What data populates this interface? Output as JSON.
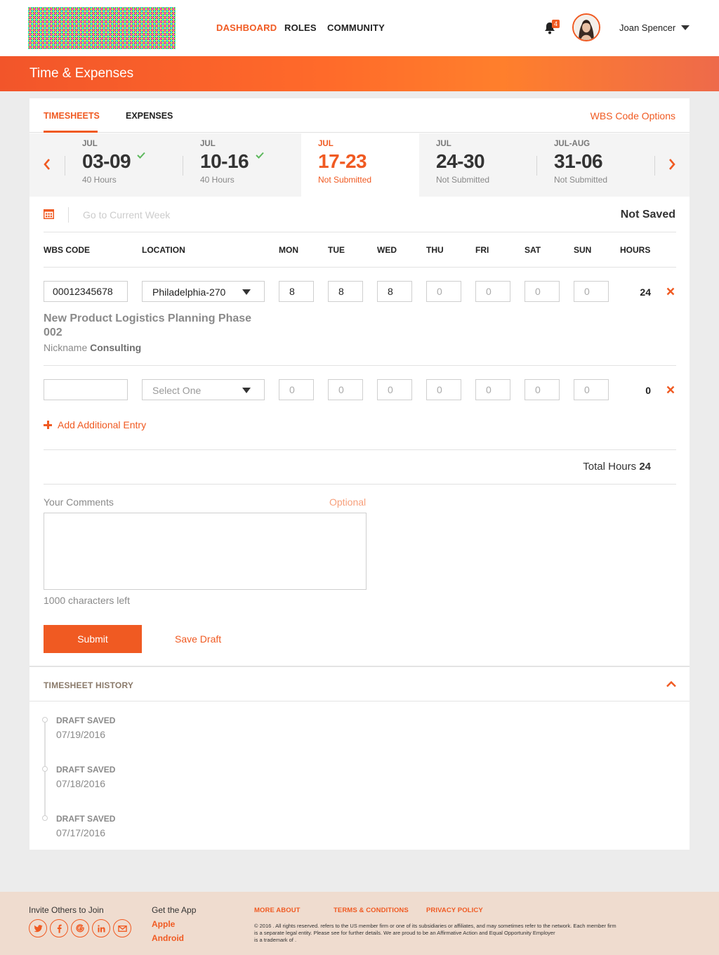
{
  "header": {
    "nav": [
      "DASHBOARD",
      "ROLES",
      "COMMUNITY"
    ],
    "notifications_count": "4",
    "user_name": "Joan Spencer"
  },
  "banner": {
    "title": "Time & Expenses"
  },
  "tabs": [
    "TIMESHEETS",
    "EXPENSES"
  ],
  "wbs_options": "WBS Code Options",
  "weeks": [
    {
      "month": "JUL",
      "range": "03-09",
      "status": "40 Hours",
      "approved": true
    },
    {
      "month": "JUL",
      "range": "10-16",
      "status": "40 Hours",
      "approved": true
    },
    {
      "month": "JUL",
      "range": "17-23",
      "status": "Not Submitted",
      "selected": true
    },
    {
      "month": "JUL",
      "range": "24-30",
      "status": "Not Submitted"
    },
    {
      "month": "JUL-AUG",
      "range": "31-06",
      "status": "Not Submitted"
    }
  ],
  "toolbar": {
    "go_current": "Go to Current Week",
    "save_state": "Not Saved"
  },
  "columns": [
    "WBS CODE",
    "LOCATION",
    "MON",
    "TUE",
    "WED",
    "THU",
    "FRI",
    "SAT",
    "SUN",
    "HOURS"
  ],
  "rows": [
    {
      "wbs_code": "00012345678",
      "location": "Philadelphia-270",
      "days": [
        "8",
        "8",
        "8",
        "",
        "",
        "",
        ""
      ],
      "day_placeholder": "0",
      "hours": "24",
      "project": "New Product Logistics Planning Phase 002",
      "nickname_label": "Nickname",
      "nickname": "Consulting"
    },
    {
      "wbs_code": "",
      "location": "Select One",
      "days": [
        "",
        "",
        "",
        "",
        "",
        "",
        ""
      ],
      "day_placeholder": "0",
      "hours": "0"
    }
  ],
  "add_entry": "Add Additional Entry",
  "totals": {
    "label": "Total Hours",
    "value": "24"
  },
  "comments": {
    "label": "Your Comments",
    "optional": "Optional",
    "chars_left": "1000 characters left"
  },
  "actions": {
    "submit": "Submit",
    "save_draft": "Save Draft"
  },
  "history": {
    "title": "TIMESHEET HISTORY",
    "entries": [
      {
        "status": "DRAFT SAVED",
        "date": "07/19/2016"
      },
      {
        "status": "DRAFT SAVED",
        "date": "07/18/2016"
      },
      {
        "status": "DRAFT SAVED",
        "date": "07/17/2016"
      }
    ]
  },
  "footer": {
    "invite": "Invite Others to Join",
    "social_icons": [
      "twitter-icon",
      "facebook-icon",
      "google-icon",
      "linkedin-icon",
      "email-icon"
    ],
    "get_app": "Get the App",
    "apps": [
      "Apple",
      "Android"
    ],
    "links": [
      "MORE ABOUT",
      "TERMS & CONDITIONS",
      "PRIVACY POLICY"
    ],
    "legal_1": "© 2016 . All rights reserved. refers to the US member firm or one of its subsidiaries or affiliates, and may sometimes refer to the network. Each member firm",
    "legal_2": "is a separate legal entity. Please see for further details. We are proud to be an Affirmative Action and Equal Opportunity Employer",
    "legal_3": "is a trademark of ."
  },
  "colors": {
    "accent": "#f05a22",
    "footer_bg": "#efdccf",
    "approved": "#5cb85c"
  }
}
